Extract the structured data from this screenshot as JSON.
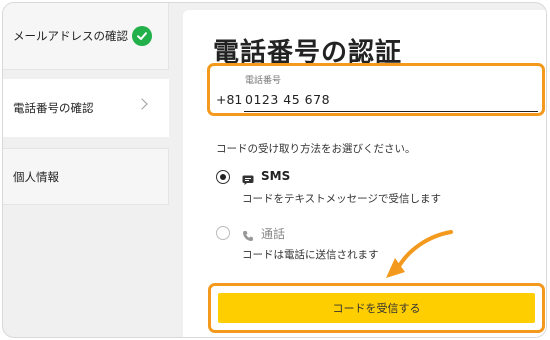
{
  "steps": [
    {
      "label": "メールアドレスの確認",
      "state": "done"
    },
    {
      "label": "電話番号の確認",
      "state": "current"
    },
    {
      "label": "個人情報",
      "state": "pending"
    }
  ],
  "main": {
    "title": "電話番号の認証",
    "phone_field": {
      "label": "電話番号",
      "country_code": "+81",
      "value": "0123 45 678"
    },
    "prompt": "コードの受け取り方法をお選びください。",
    "options": [
      {
        "title": "SMS",
        "description": "コードをテキストメッセージで受信します",
        "selected": true,
        "icon": "message-icon"
      },
      {
        "title": "通話",
        "description": "コードは電話に送信されます",
        "selected": false,
        "icon": "phone-icon"
      }
    ],
    "send_button": "コードを受信する"
  },
  "colors": {
    "highlight": "#f39a1e",
    "button": "#ffce00",
    "check": "#21b04a"
  }
}
